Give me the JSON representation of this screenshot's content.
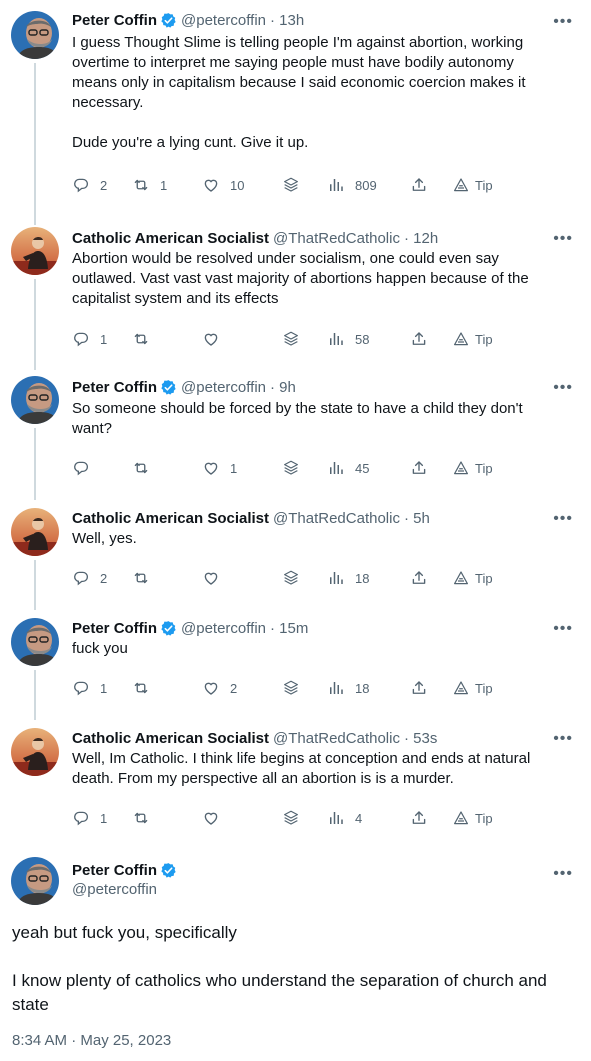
{
  "thread": [
    {
      "name": "Peter Coffin",
      "verified": true,
      "handle": "@petercoffin",
      "time": "· 13h",
      "paragraphs": [
        "I guess Thought Slime is telling people I'm against abortion, working overtime to interpret me saying people must have bodily autonomy means only in capitalism because I said economic coercion makes it necessary.",
        "Dude you're a lying cunt. Give it up."
      ],
      "replies": "2",
      "retweets": "1",
      "likes": "10",
      "views": "809",
      "tip": "Tip"
    },
    {
      "name": "Catholic American Socialist",
      "verified": false,
      "handle": "@ThatRedCatholic",
      "time": "· 12h",
      "paragraphs": [
        "Abortion would be resolved under socialism, one could even say outlawed. Vast vast vast majority of abortions happen because of the capitalist system and its effects"
      ],
      "replies": "1",
      "retweets": "",
      "likes": "",
      "views": "58",
      "tip": "Tip"
    },
    {
      "name": "Peter Coffin",
      "verified": true,
      "handle": "@petercoffin",
      "time": "· 9h",
      "paragraphs": [
        "So someone should be forced by the state to have a child they don't want?"
      ],
      "replies": "",
      "retweets": "",
      "likes": "1",
      "views": "45",
      "tip": "Tip"
    },
    {
      "name": "Catholic American Socialist",
      "verified": false,
      "handle": "@ThatRedCatholic",
      "time": "· 5h",
      "paragraphs": [
        "Well, yes."
      ],
      "replies": "2",
      "retweets": "",
      "likes": "",
      "views": "18",
      "tip": "Tip"
    },
    {
      "name": "Peter Coffin",
      "verified": true,
      "handle": "@petercoffin",
      "time": "· 15m",
      "paragraphs": [
        "fuck you"
      ],
      "replies": "1",
      "retweets": "",
      "likes": "2",
      "views": "18",
      "tip": "Tip"
    },
    {
      "name": "Catholic American Socialist",
      "verified": false,
      "handle": "@ThatRedCatholic",
      "time": "· 53s",
      "paragraphs": [
        "Well, Im Catholic. I think life begins at conception and ends at natural death. From my perspective all an abortion is is a murder."
      ],
      "replies": "1",
      "retweets": "",
      "likes": "",
      "views": "4",
      "tip": "Tip"
    }
  ],
  "main_tweet": {
    "name": "Peter Coffin",
    "verified": true,
    "handle": "@petercoffin",
    "paragraphs": [
      "yeah but fuck you, specifically",
      "I know plenty of catholics who understand the separation of church and state"
    ],
    "timestamp": "8:34 AM · May 25, 2023"
  },
  "colors": {
    "text": "#0f1419",
    "secondary": "#536471",
    "verified": "#1d9bf0",
    "thread_line": "#cfd9de"
  }
}
